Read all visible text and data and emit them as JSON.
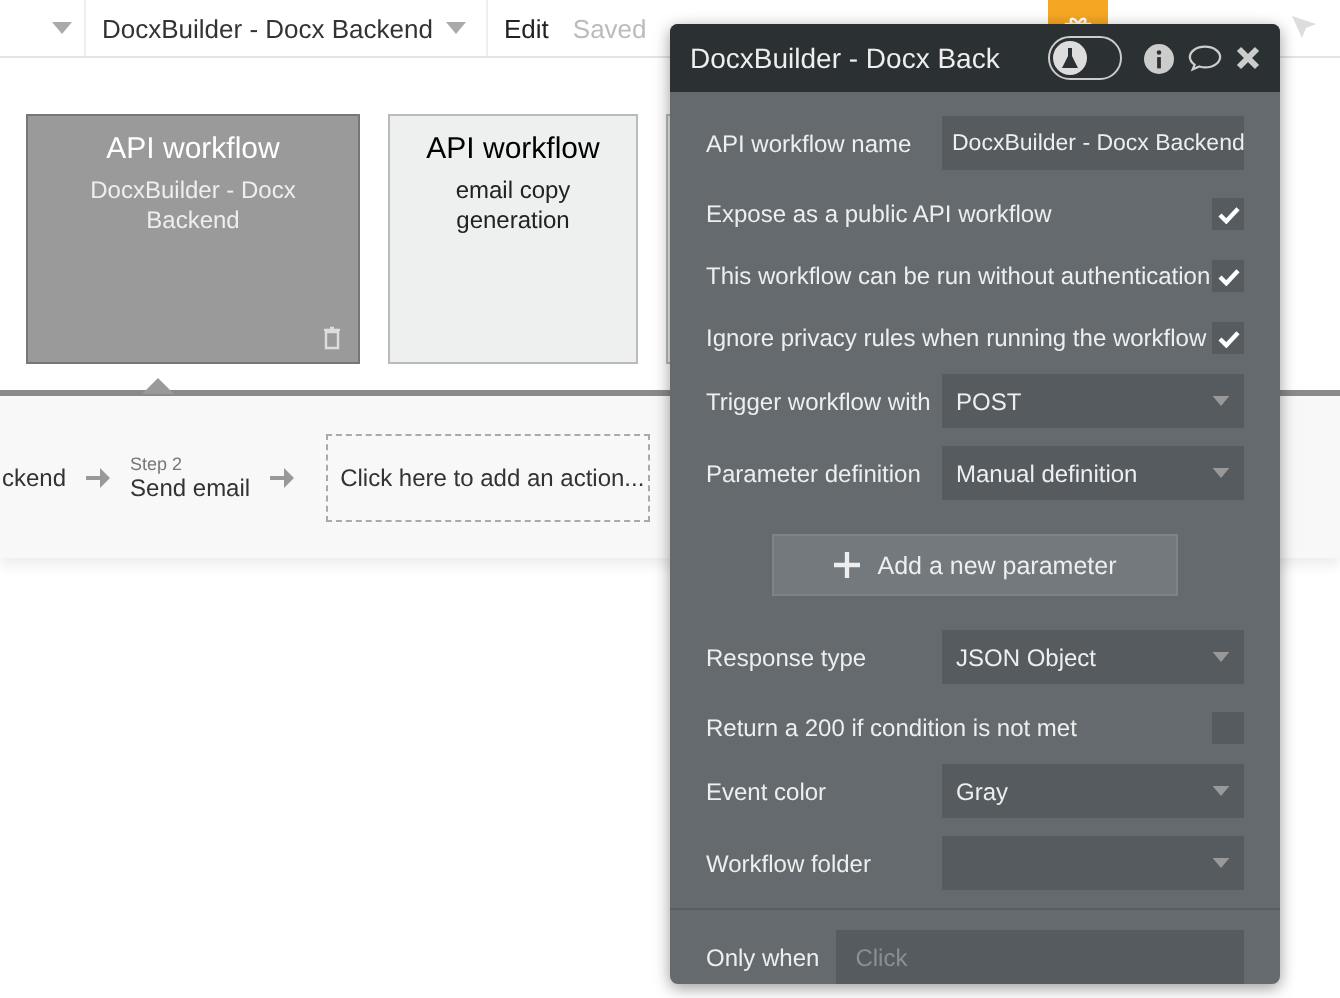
{
  "top_bar": {
    "page_dropdown": "DocxBuilder - Docx Backend",
    "mode": "Edit",
    "save_status": "Saved"
  },
  "workflow_cards": [
    {
      "title": "API workflow",
      "subtitle": "DocxBuilder - Docx Backend",
      "selected": true
    },
    {
      "title": "API workflow",
      "subtitle": "email copy generation",
      "selected": false
    }
  ],
  "steps": [
    {
      "name": "ckend"
    },
    {
      "step_label": "Step 2",
      "name": "Send email"
    }
  ],
  "add_action": "Click here to add an action...",
  "panel": {
    "title": "DocxBuilder - Docx Back",
    "debug_on": false,
    "rows": [
      {
        "kind": "text",
        "label": "API workflow name",
        "value": "DocxBuilder - Docx Backend"
      },
      {
        "kind": "checkbox",
        "label": "Expose as a public API workflow",
        "checked": true
      },
      {
        "kind": "checkbox",
        "label": "This workflow can be run without authentication",
        "checked": true
      },
      {
        "kind": "checkbox",
        "label": "Ignore privacy rules when running the workflow",
        "checked": true
      },
      {
        "kind": "dropdown",
        "label": "Trigger workflow with",
        "value": "POST"
      },
      {
        "kind": "dropdown",
        "label": "Parameter definition",
        "value": "Manual definition"
      },
      {
        "kind": "button",
        "label": "Add a new parameter"
      },
      {
        "kind": "dropdown",
        "label": "Response type",
        "value": "JSON Object"
      },
      {
        "kind": "checkbox",
        "label": "Return a 200 if condition is not met",
        "checked": false
      },
      {
        "kind": "dropdown",
        "label": "Event color",
        "value": "Gray"
      },
      {
        "kind": "dropdown",
        "label": "Workflow folder"
      }
    ],
    "only_when": {
      "label": "Only when",
      "placeholder": "Click"
    }
  }
}
